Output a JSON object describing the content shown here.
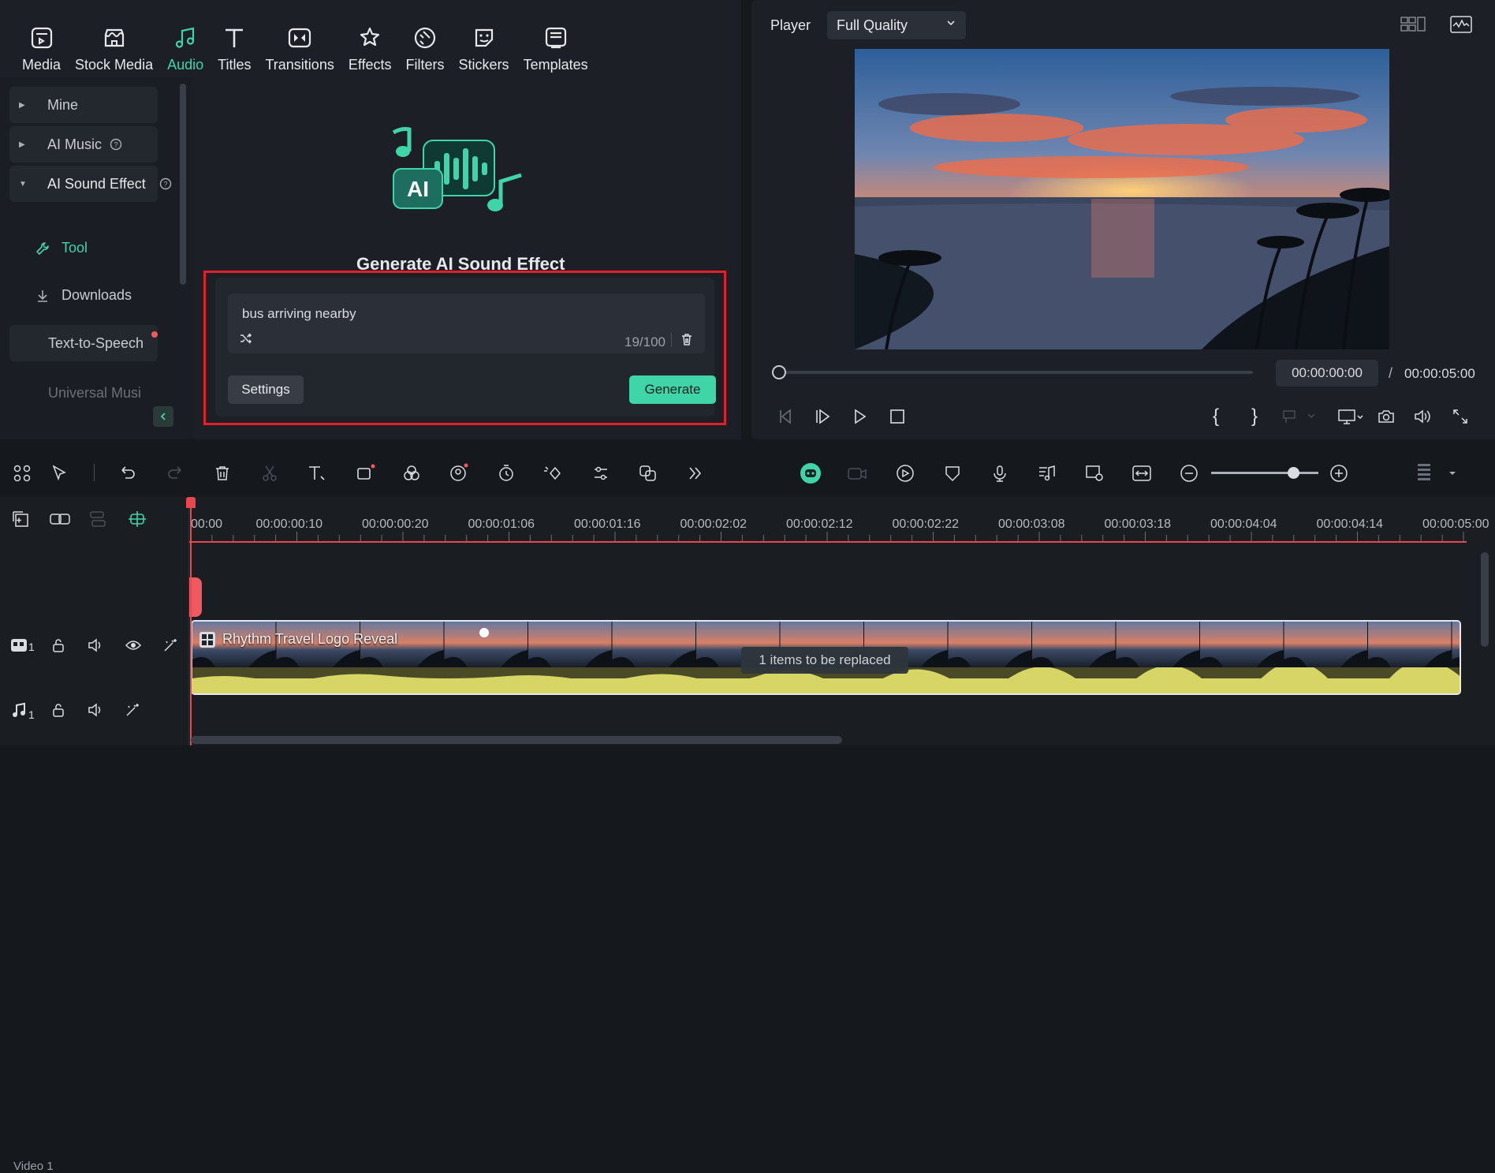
{
  "media_tabs": [
    {
      "label": "Media",
      "icon": "media-icon"
    },
    {
      "label": "Stock Media",
      "icon": "stock-media-icon"
    },
    {
      "label": "Audio",
      "icon": "audio-icon",
      "active": true
    },
    {
      "label": "Titles",
      "icon": "titles-icon"
    },
    {
      "label": "Transitions",
      "icon": "transitions-icon"
    },
    {
      "label": "Effects",
      "icon": "effects-icon"
    },
    {
      "label": "Filters",
      "icon": "filters-icon"
    },
    {
      "label": "Stickers",
      "icon": "stickers-icon"
    },
    {
      "label": "Templates",
      "icon": "templates-icon"
    }
  ],
  "sidebar": {
    "mine": "Mine",
    "ai_music": "AI Music",
    "ai_sound_effect": "AI Sound Effect",
    "tool": "Tool",
    "downloads": "Downloads",
    "tts": "Text-to-Speech",
    "universal": "Universal Musi"
  },
  "generator": {
    "title": "Generate AI Sound Effect",
    "prompt": "bus arriving nearby",
    "char_count": "19/100",
    "settings": "Settings",
    "generate": "Generate"
  },
  "player": {
    "label": "Player",
    "quality": "Full Quality",
    "time_current": "00:00:00:00",
    "time_separator": "/",
    "time_total": "00:00:05:00"
  },
  "ruler": [
    "00:00",
    "00:00:00:10",
    "00:00:00:20",
    "00:00:01:06",
    "00:00:01:16",
    "00:00:02:02",
    "00:00:02:12",
    "00:00:02:22",
    "00:00:03:08",
    "00:00:03:18",
    "00:00:04:04",
    "00:00:04:14",
    "00:00:05:00"
  ],
  "timeline": {
    "clip_title": "Rhythm Travel Logo Reveal",
    "replace_tip": "1 items to be replaced",
    "video_track_num": "1",
    "video_track_label": "Video 1",
    "audio_track_num": "1"
  },
  "colors": {
    "accent": "#3fd5a9",
    "highlight_border": "#e3202a",
    "playhead": "#e9474f"
  }
}
